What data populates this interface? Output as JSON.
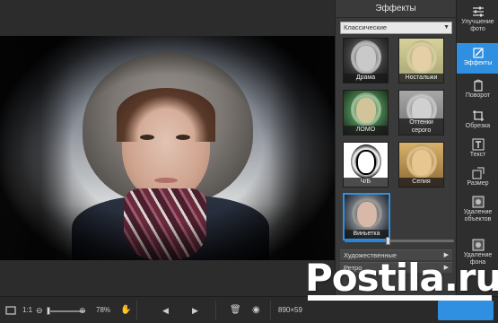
{
  "panel": {
    "title": "Эффекты",
    "category": "Классические",
    "effects": [
      {
        "label": "Драма"
      },
      {
        "label": "Ностальжи"
      },
      {
        "label": "ЛОМО"
      },
      {
        "label": "Оттенки серого"
      },
      {
        "label": "Ч/Б"
      },
      {
        "label": "Сепия"
      },
      {
        "label": "Виньетка"
      }
    ],
    "selected_effect": "Виньетка",
    "intensity": 0.4,
    "sections": [
      "Художественные",
      "Ретро"
    ]
  },
  "tools": [
    {
      "label": "Улучшение фото",
      "icon": "sliders-icon"
    },
    {
      "label": "Эффекты",
      "icon": "effects-icon",
      "active": true
    },
    {
      "label": "Поворот",
      "icon": "rotate-icon"
    },
    {
      "label": "Обрезка",
      "icon": "crop-icon"
    },
    {
      "label": "Текст",
      "icon": "text-icon"
    },
    {
      "label": "Размер",
      "icon": "resize-icon"
    },
    {
      "label": "Удаление объектов",
      "icon": "eraser-icon"
    },
    {
      "label": "Удаление фона",
      "icon": "background-icon"
    }
  ],
  "bottombar": {
    "fit_label": "1:1",
    "zoom_percent": "78%",
    "image_size": "890×59"
  },
  "watermark": "Postila.ru",
  "colors": {
    "accent": "#2f8fe0",
    "panel": "#3a3a3a",
    "background": "#2d2d2d"
  }
}
